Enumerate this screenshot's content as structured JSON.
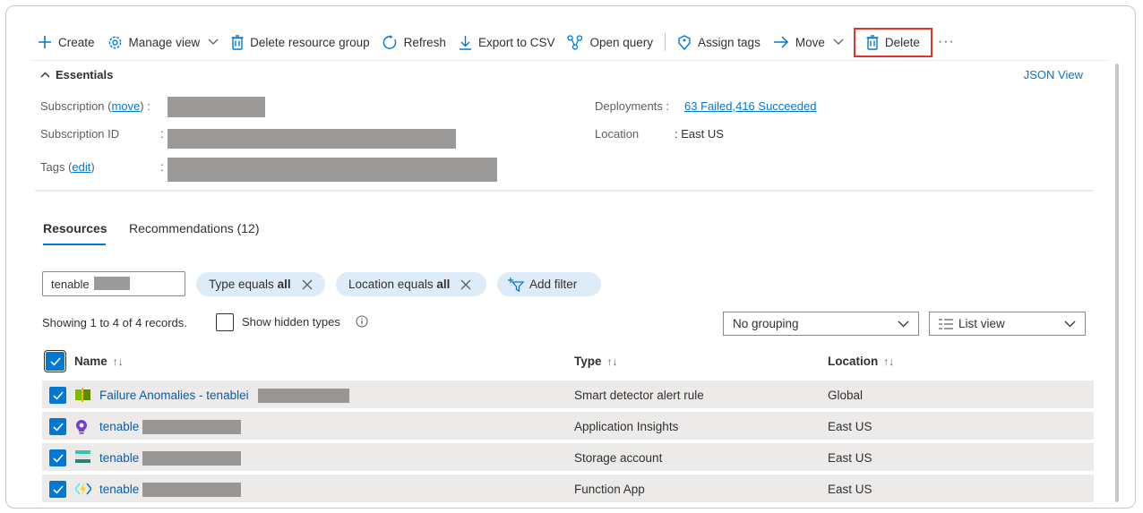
{
  "toolbar": {
    "create": "Create",
    "manage_view": "Manage view",
    "delete_rg": "Delete resource group",
    "refresh": "Refresh",
    "export_csv": "Export to CSV",
    "open_query": "Open query",
    "assign_tags": "Assign tags",
    "move": "Move",
    "delete": "Delete",
    "more": "···"
  },
  "essentials": {
    "title": "Essentials",
    "json_view": "JSON View",
    "subscription_label": "Subscription",
    "subscription_move": "move",
    "subscription_id_label": "Subscription ID",
    "tags_label": "Tags",
    "tags_edit": "edit",
    "deployments_label": "Deployments",
    "deployments_value": "63 Failed,416 Succeeded",
    "location_label": "Location",
    "location_value": "East US"
  },
  "tabs": [
    {
      "label": "Resources",
      "active": true
    },
    {
      "label": "Recommendations (12)",
      "active": false
    }
  ],
  "filters": {
    "search_value": "tenable",
    "type_filter": {
      "label": "Type equals",
      "value": "all"
    },
    "location_filter": {
      "label": "Location equals",
      "value": "all"
    },
    "add_filter": "Add filter"
  },
  "records": {
    "showing": "Showing 1 to 4 of 4 records.",
    "show_hidden": "Show hidden types",
    "grouping": "No grouping",
    "view": "List view"
  },
  "table": {
    "columns": [
      "Name",
      "Type",
      "Location"
    ],
    "rows": [
      {
        "name": "Failure Anomalies - tenablei",
        "type": "Smart detector alert rule",
        "location": "Global",
        "icon": "smart-detector-icon"
      },
      {
        "name": "tenable",
        "type": "Application Insights",
        "location": "East US",
        "icon": "app-insights-icon"
      },
      {
        "name": "tenable",
        "type": "Storage account",
        "location": "East US",
        "icon": "storage-icon"
      },
      {
        "name": "tenable",
        "type": "Function App",
        "location": "East US",
        "icon": "function-app-icon"
      }
    ]
  },
  "colors": {
    "accent": "#0078d4",
    "highlight": "#e0352b",
    "pill": "#deecf9",
    "row": "#edebe9"
  }
}
